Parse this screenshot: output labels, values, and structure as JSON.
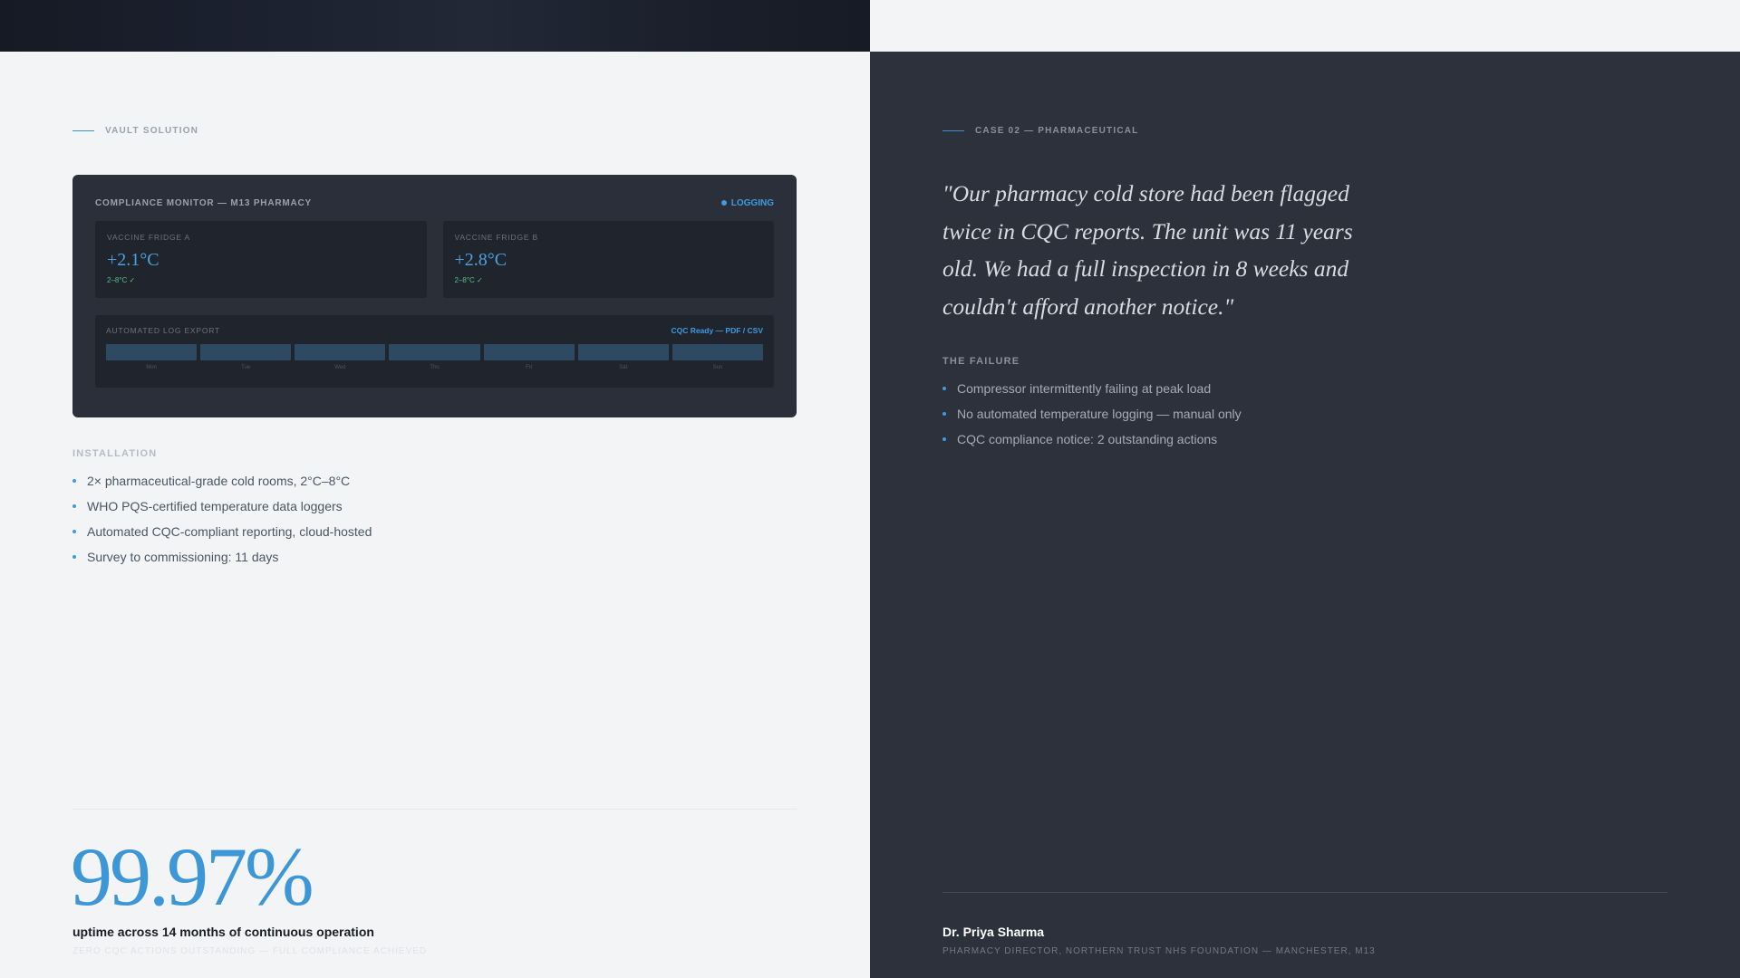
{
  "left": {
    "eyebrow": "VAULT SOLUTION",
    "monitor": {
      "title": "COMPLIANCE MONITOR — M13 PHARMACY",
      "status": "LOGGING",
      "fridges": [
        {
          "label": "VACCINE FRIDGE A",
          "temp": "+2.1°C",
          "range": "2–8°C ✓"
        },
        {
          "label": "VACCINE FRIDGE B",
          "temp": "+2.8°C",
          "range": "2–8°C ✓"
        }
      ],
      "log": {
        "title": "AUTOMATED LOG EXPORT",
        "tag": "CQC Ready — PDF / CSV",
        "days": [
          "Mon",
          "Tue",
          "Wed",
          "Thu",
          "Fri",
          "Sat",
          "Sun"
        ]
      }
    },
    "installation": {
      "label": "INSTALLATION",
      "items": [
        "2× pharmaceutical-grade cold rooms, 2°C–8°C",
        "WHO PQS-certified temperature data loggers",
        "Automated CQC-compliant reporting, cloud-hosted",
        "Survey to commissioning: 11 days"
      ]
    },
    "stat": {
      "value": "99.97%",
      "caption": "uptime across 14 months of continuous operation",
      "sub": "ZERO CQC ACTIONS OUTSTANDING — FULL COMPLIANCE ACHIEVED"
    }
  },
  "right": {
    "eyebrow": "CASE 02 — PHARMACEUTICAL",
    "quote": "\"Our pharmacy cold store had been flagged twice in CQC reports. The unit was 11 years old. We had a full inspection in 8 weeks and couldn't afford another notice.\"",
    "failure": {
      "label": "THE FAILURE",
      "items": [
        "Compressor intermittently failing at peak load",
        "No automated temperature logging — manual only",
        "CQC compliance notice: 2 outstanding actions"
      ]
    },
    "author": {
      "name": "Dr. Priya Sharma",
      "role": "PHARMACY DIRECTOR, NORTHERN TRUST NHS FOUNDATION — MANCHESTER, M13"
    }
  },
  "colors": {
    "accent": "#3d96d6",
    "dark_panel": "#2c313b",
    "ok_green": "#4ec08a"
  }
}
